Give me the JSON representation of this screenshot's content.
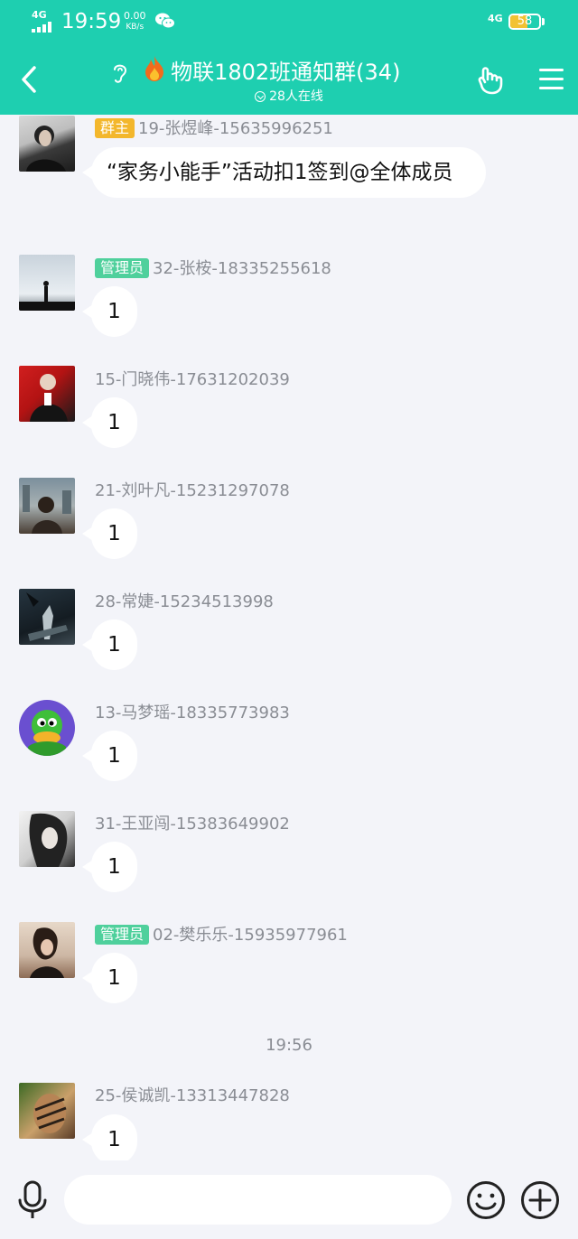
{
  "status_bar": {
    "network": "4G",
    "time": "19:59",
    "speed_value": "0.00",
    "speed_unit": "KB/s",
    "network_right": "4G",
    "battery": "58",
    "battery_level": 0.58
  },
  "header": {
    "title": "物联1802班通知群(34)",
    "online": "28人在线"
  },
  "messages": [
    {
      "badge": "群主",
      "sender": "19-张煜峰-15635996251",
      "text": "“家务小能手”活动扣1签到@全体成员"
    },
    {
      "badge": "管理员",
      "sender": "32-张桉-18335255618",
      "text": "1"
    },
    {
      "badge": "",
      "sender": "15-门晓伟-17631202039",
      "text": "1"
    },
    {
      "badge": "",
      "sender": "21-刘叶凡-15231297078",
      "text": "1"
    },
    {
      "badge": "",
      "sender": "28-常婕-15234513998",
      "text": "1"
    },
    {
      "badge": "",
      "sender": "13-马梦瑶-18335773983",
      "text": "1"
    },
    {
      "badge": "",
      "sender": "31-王亚闯-15383649902",
      "text": "1"
    },
    {
      "badge": "管理员",
      "sender": "02-樊乐乐-15935977961",
      "text": "1"
    },
    {
      "badge": "",
      "sender": "25-侯诚凯-13313447828",
      "text": "1"
    }
  ],
  "timestamp": "19:56",
  "colors": {
    "header_bg": "#1ecfb0",
    "owner_badge": "#f3b72c",
    "admin_badge": "#4fd09c",
    "chat_bg": "#f3f4f9"
  },
  "icons": [
    "back-arrow-icon",
    "ear-icon",
    "fire-emoji-icon",
    "gesture-icon",
    "menu-icon",
    "mic-icon",
    "emoji-icon",
    "plus-icon",
    "wechat-icon"
  ]
}
